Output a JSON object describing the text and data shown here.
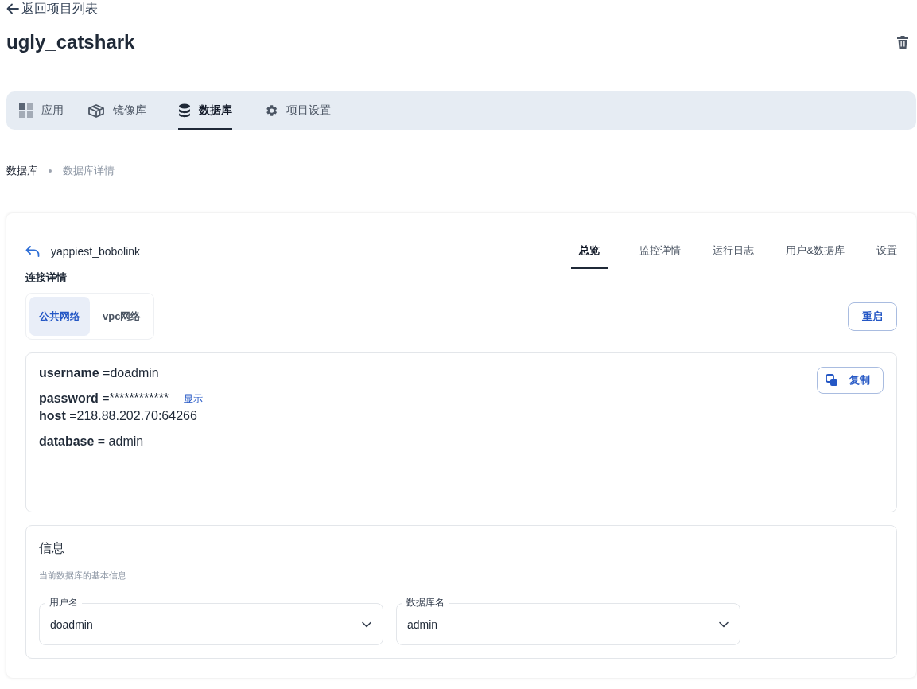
{
  "back_link": {
    "label": "返回项目列表"
  },
  "project": {
    "title": "ugly_catshark"
  },
  "tabs": [
    {
      "label": "应用",
      "kind": "grid",
      "selected": false
    },
    {
      "label": "镜像库",
      "kind": "box",
      "selected": false
    },
    {
      "label": "数据库",
      "kind": "database",
      "selected": true
    },
    {
      "label": "项目设置",
      "kind": "gear",
      "selected": false
    }
  ],
  "breadcrumb": [
    {
      "label": "数据库",
      "current": false
    },
    {
      "label": "数据库详情",
      "current": true
    }
  ],
  "database": {
    "name": "yappiest_bobolink",
    "tabs": [
      {
        "label": "总览",
        "selected": true
      },
      {
        "label": "监控详情",
        "selected": false
      },
      {
        "label": "运行日志",
        "selected": false
      },
      {
        "label": "用户&数据库",
        "selected": false
      },
      {
        "label": "设置",
        "selected": false
      }
    ]
  },
  "connection": {
    "heading": "连接详情",
    "networks": [
      {
        "label": "公共网络",
        "selected": true
      },
      {
        "label": "vpc网络",
        "selected": false
      }
    ],
    "restart_button": "重启",
    "fields": [
      {
        "key": "username",
        "value": " =doadmin"
      },
      {
        "key": "password",
        "value": " =************",
        "action": "显示"
      },
      {
        "key": "host",
        "value": " =218.88.202.70:64266"
      },
      {
        "key": "database",
        "value": " = admin"
      }
    ],
    "copy_button": "复制"
  },
  "info": {
    "title": "信息",
    "subtitle": "当前数据库的基本信息",
    "selects": [
      {
        "label": "用户名",
        "value": "doadmin"
      },
      {
        "label": "数据库名",
        "value": "admin"
      }
    ]
  }
}
